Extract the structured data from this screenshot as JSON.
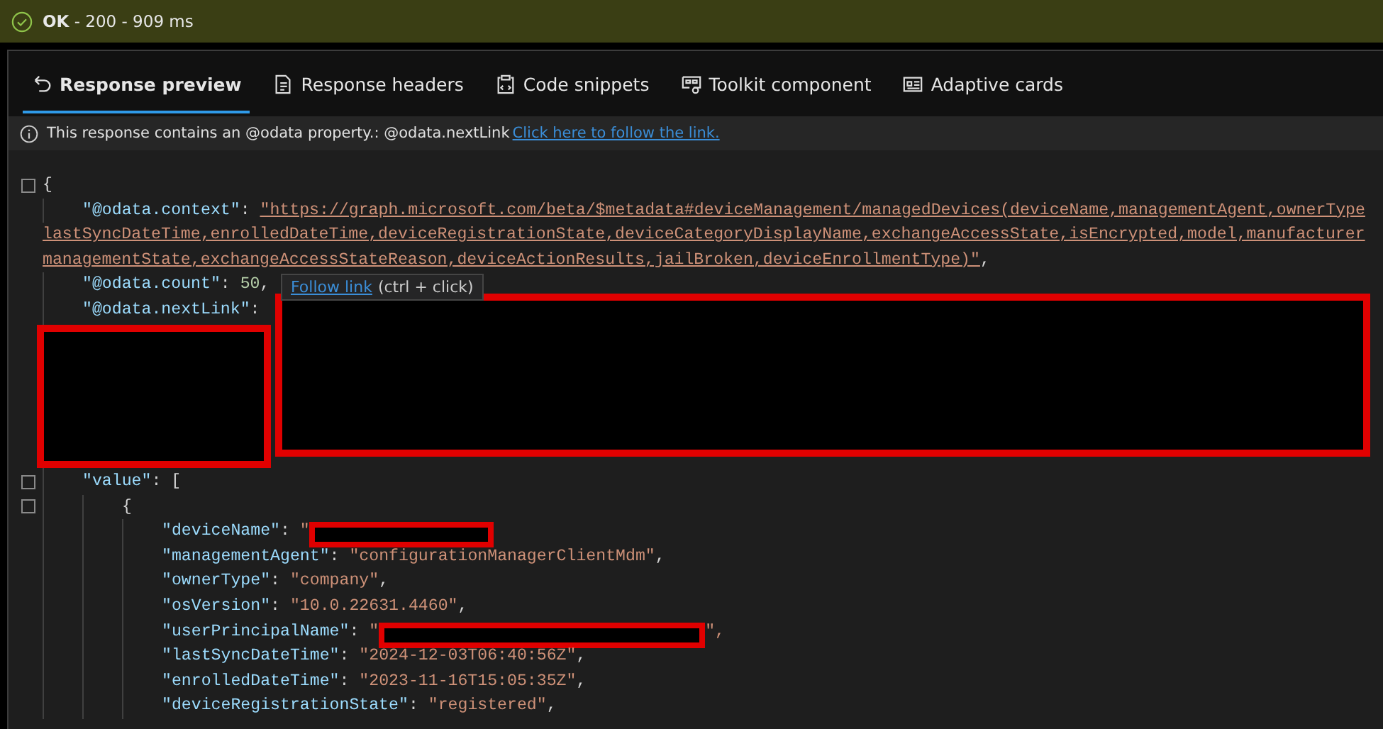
{
  "status": {
    "text": "**OK** - 200 - 909 ms",
    "ok": true
  },
  "tabs": [
    {
      "label": "Response preview",
      "selected": true
    },
    {
      "label": "Response headers",
      "selected": false
    },
    {
      "label": "Code snippets",
      "selected": false
    },
    {
      "label": "Toolkit component",
      "selected": false
    },
    {
      "label": "Adaptive cards",
      "selected": false
    }
  ],
  "notice": {
    "text": "This response contains an @odata property.: @odata.nextLink",
    "link": "Click here to follow the link."
  },
  "tooltip": {
    "link": "Follow link",
    "hint": "(ctrl + click)"
  },
  "code": {
    "separator": ": ",
    "open": "{",
    "children": [
      {
        "kind": "link",
        "key": "\"@odata.context\"",
        "lines": [
          "\"https://graph.microsoft.com/beta/$metadata#deviceManagement/managedDevices(deviceName,managementAgent,ownerType",
          "lastSyncDateTime,enrolledDateTime,deviceRegistrationState,deviceCategoryDisplayName,exchangeAccessState,isEncrypted,model,manufacturer",
          "managementState,exchangeAccessStateReason,deviceActionResults,jailBroken,deviceEnrollmentType)\""
        ],
        "after": ","
      },
      {
        "kind": "number",
        "key": "\"@odata.count\"",
        "value": "50",
        "after": ","
      },
      {
        "kind": "redacted-block",
        "key": "\"@odata.nextLink\""
      },
      {
        "kind": "array",
        "key": "\"value\"",
        "open": "[",
        "children": [
          {
            "kind": "object",
            "open": "{",
            "children": [
              {
                "kind": "redacted",
                "key": "\"deviceName\"",
                "before": "\""
              },
              {
                "kind": "string",
                "key": "\"managementAgent\"",
                "value": "\"configurationManagerClientMdm\"",
                "after": ","
              },
              {
                "kind": "string",
                "key": "\"ownerType\"",
                "value": "\"company\"",
                "after": ","
              },
              {
                "kind": "string",
                "key": "\"osVersion\"",
                "value": "\"10.0.22631.4460\"",
                "after": ","
              },
              {
                "kind": "redacted",
                "key": "\"userPrincipalName\"",
                "before": "\"",
                "after": "\","
              },
              {
                "kind": "string",
                "key": "\"lastSyncDateTime\"",
                "value": "\"2024-12-03T06:40:56Z\"",
                "after": ","
              },
              {
                "kind": "string",
                "key": "\"enrolledDateTime\"",
                "value": "\"2023-11-16T15:05:35Z\"",
                "after": ","
              },
              {
                "kind": "string",
                "key": "\"deviceRegistrationState\"",
                "value": "\"registered\"",
                "after": ","
              }
            ]
          }
        ]
      }
    ]
  }
}
